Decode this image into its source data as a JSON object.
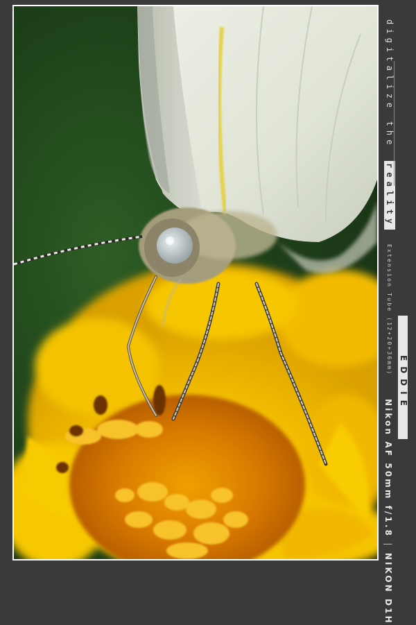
{
  "tagline": {
    "prefix": "digitalize the ",
    "highlight": "reality"
  },
  "lens_note": "Extension Tube (12+20+36mm)",
  "photographer": "EDDIE",
  "separator": "|",
  "camera": "NIKON D1H",
  "lens": "Nikon AF 50mm f/1.8",
  "colors": {
    "background": "#3a3a3a",
    "frame": "#ffffff",
    "petal": "#f6c400",
    "foliage": "#1f4a1c",
    "wing": "#e4e8dc"
  }
}
